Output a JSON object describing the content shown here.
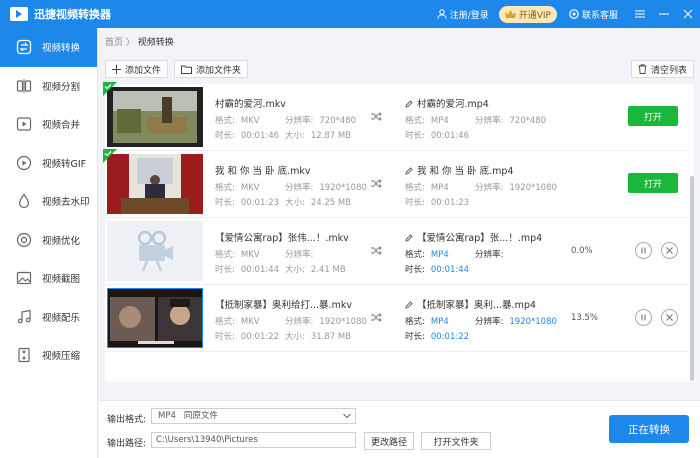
{
  "app": {
    "title": "迅捷视频转换器",
    "login": "注册/登录",
    "vip": "开通VIP",
    "service": "联系客服"
  },
  "sidebar": {
    "items": [
      {
        "label": "视频转换",
        "icon": "convert-icon",
        "active": true
      },
      {
        "label": "视频分割",
        "icon": "split-icon",
        "active": false
      },
      {
        "label": "视频合并",
        "icon": "merge-icon",
        "active": false
      },
      {
        "label": "视频转GIF",
        "icon": "gif-icon",
        "active": false
      },
      {
        "label": "视频去水印",
        "icon": "watermark-icon",
        "active": false
      },
      {
        "label": "视频优化",
        "icon": "optimize-icon",
        "active": false
      },
      {
        "label": "视频截图",
        "icon": "screenshot-icon",
        "active": false
      },
      {
        "label": "视频配乐",
        "icon": "music-icon",
        "active": false
      },
      {
        "label": "视频压缩",
        "icon": "compress-icon",
        "active": false
      }
    ]
  },
  "breadcrumb": {
    "home": "首页",
    "sep": "〉",
    "current": "视频转换"
  },
  "toolbar": {
    "add_file": "添加文件",
    "add_folder": "添加文件夹",
    "clear": "清空列表"
  },
  "labels": {
    "format": "格式:",
    "resolution": "分辨率:",
    "duration": "时长:",
    "size": "大小:",
    "open": "打开"
  },
  "files": [
    {
      "name": "村霸的爱河.mkv",
      "format": "MKV",
      "resolution": "720*480",
      "duration": "00:01:46",
      "size": "12.87 MB",
      "out_name": "村霸的爱河.mp4",
      "out_format": "MP4",
      "out_resolution": "720*480",
      "out_duration": "00:01:46",
      "status": "done"
    },
    {
      "name": "我 和 你 当 卧 底.mkv",
      "format": "MKV",
      "resolution": "1920*1080",
      "duration": "00:01:23",
      "size": "24.25 MB",
      "out_name": "我 和 你 当 卧 底.mp4",
      "out_format": "MP4",
      "out_resolution": "1920*1080",
      "out_duration": "00:01:23",
      "status": "done"
    },
    {
      "name": "【爱情公寓rap】张伟...！.mkv",
      "format": "MKV",
      "resolution": "",
      "duration": "00:01:44",
      "size": "2.41 MB",
      "out_name": "【爱情公寓rap】张...！.mp4",
      "out_format": "MP4",
      "out_resolution": "",
      "out_duration": "00:01:44",
      "status": "converting",
      "progress": "0.0%"
    },
    {
      "name": "【抵制家暴】奥利给打...暴.mkv",
      "format": "MKV",
      "resolution": "1920*1080",
      "duration": "00:01:22",
      "size": "31.87 MB",
      "out_name": "【抵制家暴】奥利...暴.mp4",
      "out_format": "MP4",
      "out_resolution": "1920*1080",
      "out_duration": "00:01:22",
      "status": "converting",
      "progress": "13.5%"
    }
  ],
  "bottom": {
    "format_label": "输出格式:",
    "format_value": "MP4",
    "format_sub": "同原文件",
    "path_label": "输出路径:",
    "path_value": "C:\\Users\\13940\\Pictures",
    "change_path": "更改路径",
    "open_folder": "打开文件夹",
    "convert": "正在转换"
  },
  "colors": {
    "accent": "#1e88ea",
    "success": "#19b83c",
    "vip_bg": "#fce8b8"
  }
}
